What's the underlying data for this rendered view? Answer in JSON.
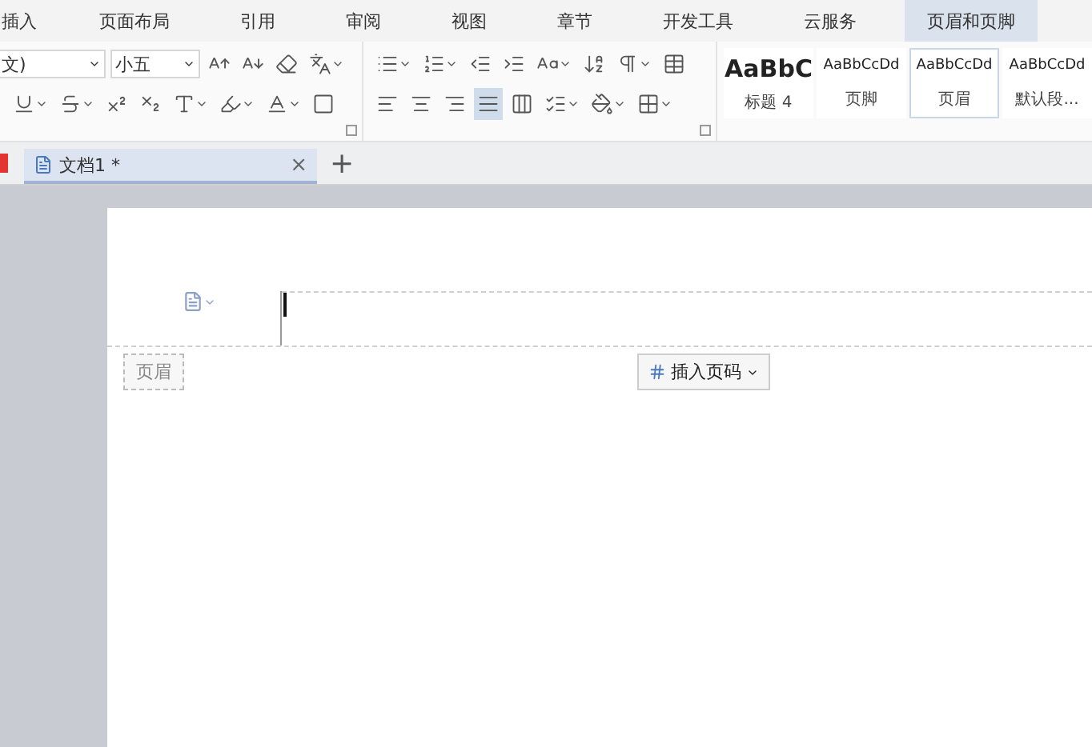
{
  "menu_tabs": [
    {
      "label": "插入",
      "selected": false
    },
    {
      "label": "页面布局",
      "selected": false
    },
    {
      "label": "引用",
      "selected": false
    },
    {
      "label": "审阅",
      "selected": false
    },
    {
      "label": "视图",
      "selected": false
    },
    {
      "label": "章节",
      "selected": false
    },
    {
      "label": "开发工具",
      "selected": false
    },
    {
      "label": "云服务",
      "selected": false
    },
    {
      "label": "页眉和页脚",
      "selected": true
    }
  ],
  "font": {
    "name": "文)",
    "size": "小五"
  },
  "alignment": [
    {
      "kind": "left",
      "selected": false
    },
    {
      "kind": "center",
      "selected": false
    },
    {
      "kind": "right",
      "selected": false
    },
    {
      "kind": "justify",
      "selected": true
    },
    {
      "kind": "distributed",
      "selected": false
    }
  ],
  "styles": [
    {
      "preview": "AaBbC",
      "label": "标题 4",
      "kind": "heading",
      "selected": false
    },
    {
      "preview": "AaBbCcDd",
      "label": "页脚",
      "kind": "normal",
      "selected": false
    },
    {
      "preview": "AaBbCcDd",
      "label": "页眉",
      "kind": "normal",
      "selected": true
    },
    {
      "preview": "AaBbCcDd",
      "label": "默认段...",
      "kind": "normal",
      "selected": false
    }
  ],
  "document_tabs": [
    {
      "title": "文档1 *",
      "close": "×",
      "selected": true
    }
  ],
  "new_tab": "+",
  "header": {
    "label": "页眉",
    "insert_page_number": "插入页码"
  }
}
